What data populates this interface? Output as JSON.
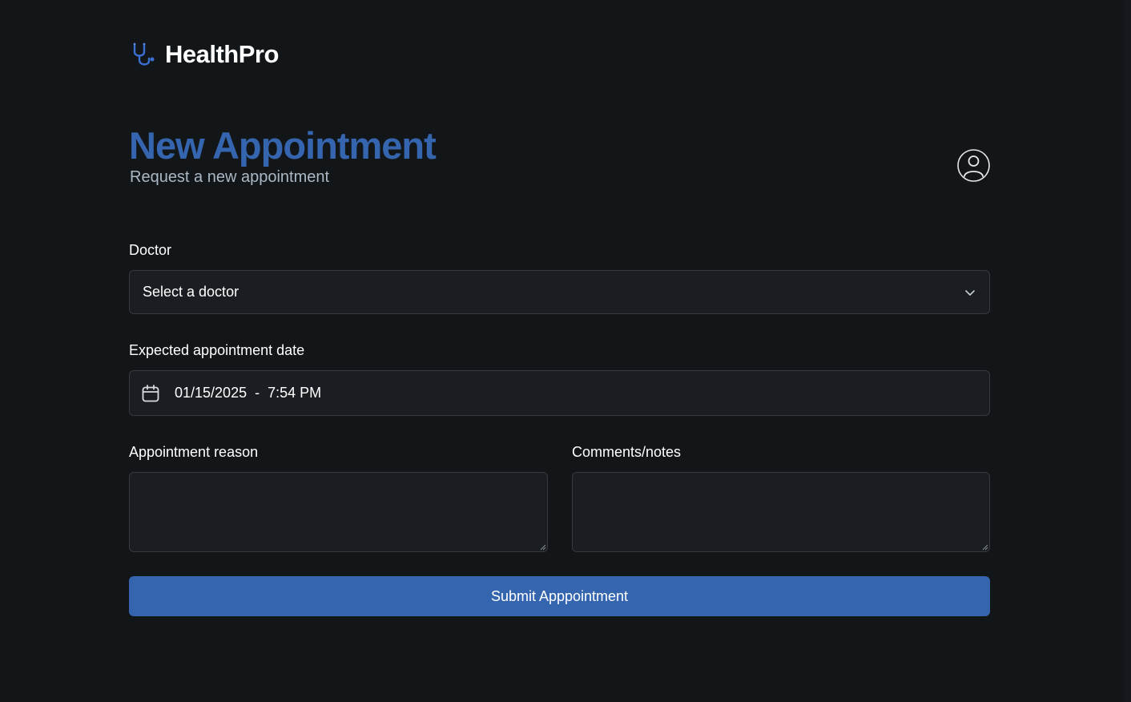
{
  "brand": {
    "name": "HealthPro",
    "logo_icon": "stethoscope-icon"
  },
  "header": {
    "title": "New Appointment",
    "subtitle": "Request a new appointment",
    "avatar_icon": "user-circle-icon"
  },
  "form": {
    "doctor": {
      "label": "Doctor",
      "value": "Select a doctor",
      "icon": "chevron-down-icon"
    },
    "date": {
      "label": "Expected appointment date",
      "value": "01/15/2025  -  7:54 PM",
      "icon": "calendar-icon"
    },
    "reason": {
      "label": "Appointment reason",
      "value": ""
    },
    "notes": {
      "label": "Comments/notes",
      "value": ""
    },
    "submit_label": "Submit Apppointment"
  },
  "colors": {
    "background": "#131619",
    "field_background": "#1a1d21",
    "field_border": "#363a3d",
    "accent": "#3465ae",
    "subtitle": "#abb8c4",
    "text": "#ffffff"
  }
}
